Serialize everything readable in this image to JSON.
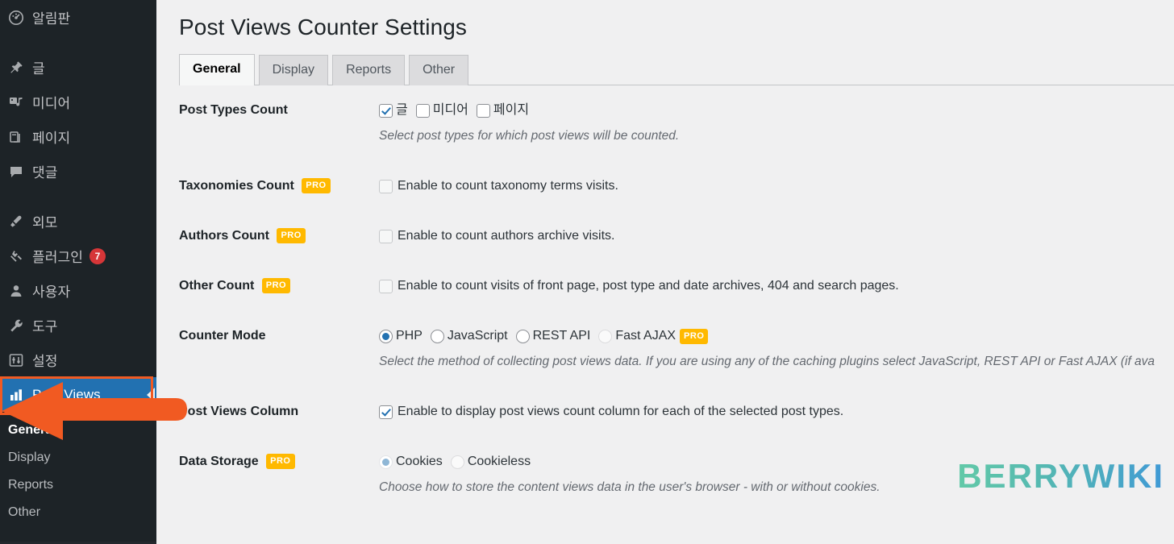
{
  "sidebar": {
    "items": [
      {
        "label": "알림판",
        "icon": "dashboard-icon",
        "group": 0
      },
      {
        "label": "글",
        "icon": "pin-icon",
        "group": 1
      },
      {
        "label": "미디어",
        "icon": "media-icon",
        "group": 1
      },
      {
        "label": "페이지",
        "icon": "page-icon",
        "group": 1
      },
      {
        "label": "댓글",
        "icon": "comment-icon",
        "group": 1
      },
      {
        "label": "외모",
        "icon": "brush-icon",
        "group": 2
      },
      {
        "label": "플러그인",
        "icon": "plug-icon",
        "group": 2,
        "badge": "7"
      },
      {
        "label": "사용자",
        "icon": "user-icon",
        "group": 2
      },
      {
        "label": "도구",
        "icon": "wrench-icon",
        "group": 2
      },
      {
        "label": "설정",
        "icon": "settings-icon",
        "group": 2
      }
    ],
    "current": {
      "label": "Post Views",
      "icon": "bar-chart-icon"
    },
    "submenu": [
      {
        "label": "General",
        "active": true
      },
      {
        "label": "Display",
        "active": false
      },
      {
        "label": "Reports",
        "active": false
      },
      {
        "label": "Other",
        "active": false
      }
    ]
  },
  "main": {
    "title": "Post Views Counter Settings",
    "tabs": [
      {
        "label": "General",
        "active": true
      },
      {
        "label": "Display",
        "active": false
      },
      {
        "label": "Reports",
        "active": false
      },
      {
        "label": "Other",
        "active": false
      }
    ],
    "rows": [
      {
        "label": "Post Types Count",
        "pro": false,
        "options": [
          {
            "label": "글",
            "checked": true
          },
          {
            "label": "미디어",
            "checked": false
          },
          {
            "label": "페이지",
            "checked": false
          }
        ],
        "description": "Select post types for which post views will be counted."
      },
      {
        "label": "Taxonomies Count",
        "pro": "PRO",
        "checkbox_label": "Enable to count taxonomy terms visits.",
        "checked": false
      },
      {
        "label": "Authors Count",
        "pro": "PRO",
        "checkbox_label": "Enable to count authors archive visits.",
        "checked": false
      },
      {
        "label": "Other Count",
        "pro": "PRO",
        "checkbox_label": "Enable to count visits of front page, post type and date archives, 404 and search pages.",
        "checked": false
      },
      {
        "label": "Counter Mode",
        "pro": false,
        "radios": [
          {
            "label": "PHP",
            "selected": true,
            "dim": false
          },
          {
            "label": "JavaScript",
            "selected": false,
            "dim": false
          },
          {
            "label": "REST API",
            "selected": false,
            "dim": false
          },
          {
            "label": "Fast AJAX",
            "selected": false,
            "dim": true,
            "pro": "PRO"
          }
        ],
        "description": "Select the method of collecting post views data. If you are using any of the caching plugins select JavaScript, REST API or Fast AJAX (if ava"
      },
      {
        "label": "Post Views Column",
        "pro": false,
        "checkbox_label": "Enable to display post views count column for each of the selected post types.",
        "checked": true
      },
      {
        "label": "Data Storage",
        "pro": "PRO",
        "radios": [
          {
            "label": "Cookies",
            "selected": true,
            "dim": true
          },
          {
            "label": "Cookieless",
            "selected": false,
            "dim": true
          }
        ],
        "description": "Choose how to store the content views data in the user's browser - with or without cookies."
      }
    ]
  },
  "watermark": {
    "text": "BERRYWIKI"
  },
  "colors": {
    "sidebar_bg": "#1d2327",
    "current_menu_bg": "#2271b1",
    "highlight_border": "#f15a22",
    "arrow": "#f15a22",
    "pro_badge": "#ffb900",
    "badge_red": "#d63638",
    "page_bg": "#f0f0f1"
  }
}
